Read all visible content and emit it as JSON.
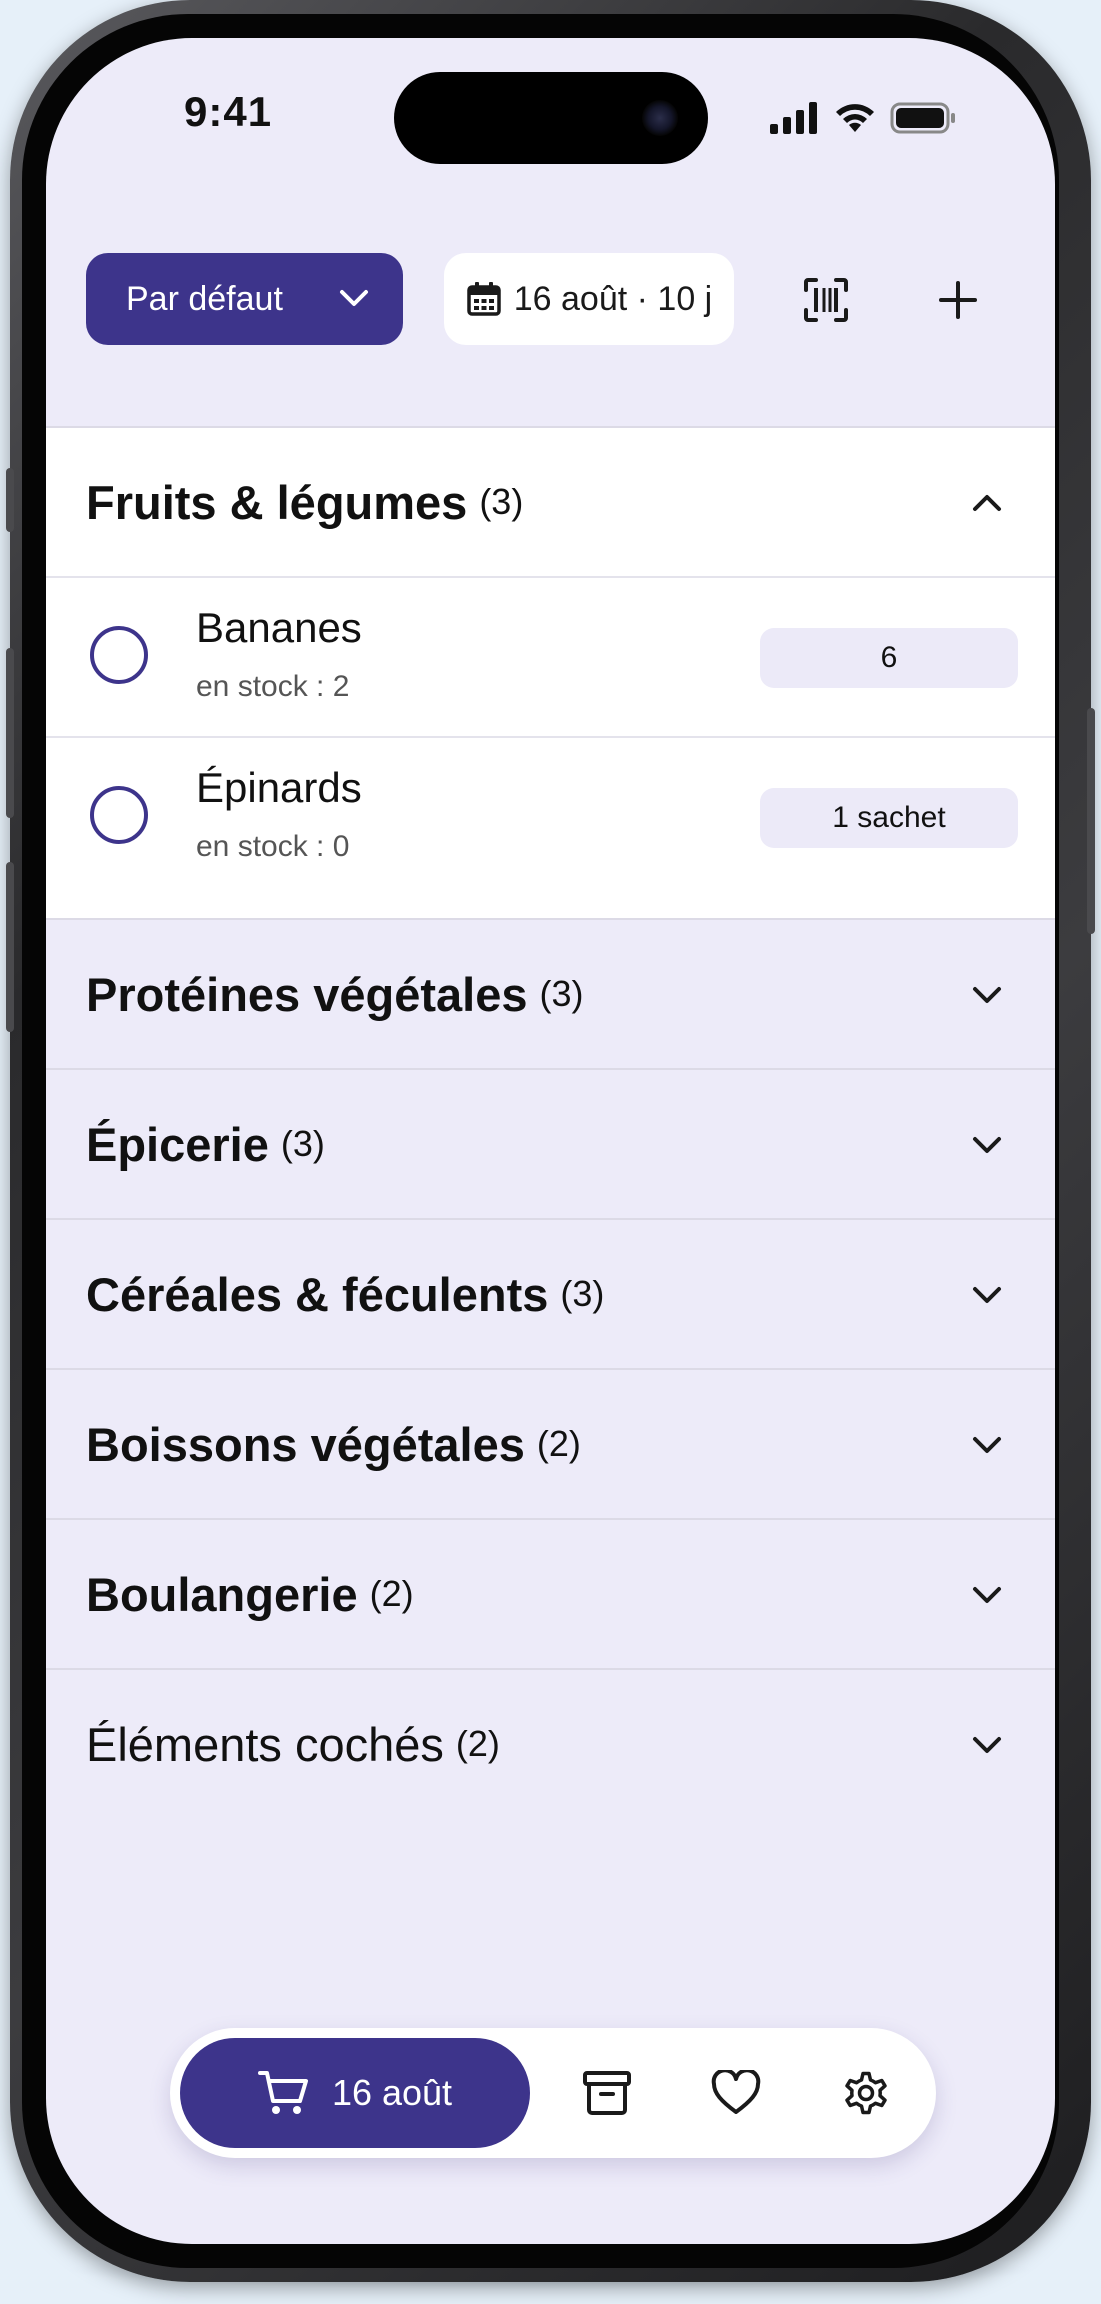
{
  "status": {
    "time": "9:41"
  },
  "toolbar": {
    "sort_label": "Par défaut",
    "date_label": "16 août · 10 j"
  },
  "sections": [
    {
      "title": "Fruits & légumes",
      "count": "(3)",
      "expanded": true,
      "items": [
        {
          "name": "Bananes",
          "stock": "en stock : 2",
          "qty": "6"
        },
        {
          "name": "Épinards",
          "stock": "en stock : 0",
          "qty": "1 sachet"
        }
      ]
    },
    {
      "title": "Protéines végétales",
      "count": "(3)"
    },
    {
      "title": "Épicerie",
      "count": "(3)"
    },
    {
      "title": "Céréales & féculents",
      "count": "(3)"
    },
    {
      "title": "Boissons végétales",
      "count": "(2)"
    },
    {
      "title": "Boulangerie",
      "count": "(2)"
    },
    {
      "title": "Éléments cochés",
      "count": "(2)"
    }
  ],
  "nav": {
    "active_label": "16 août",
    "icons": [
      "cart-icon",
      "archive-icon",
      "heart-icon",
      "gear-icon"
    ]
  },
  "colors": {
    "accent": "#3d348b",
    "background": "#edebf9",
    "pill": "#eceaf8"
  }
}
